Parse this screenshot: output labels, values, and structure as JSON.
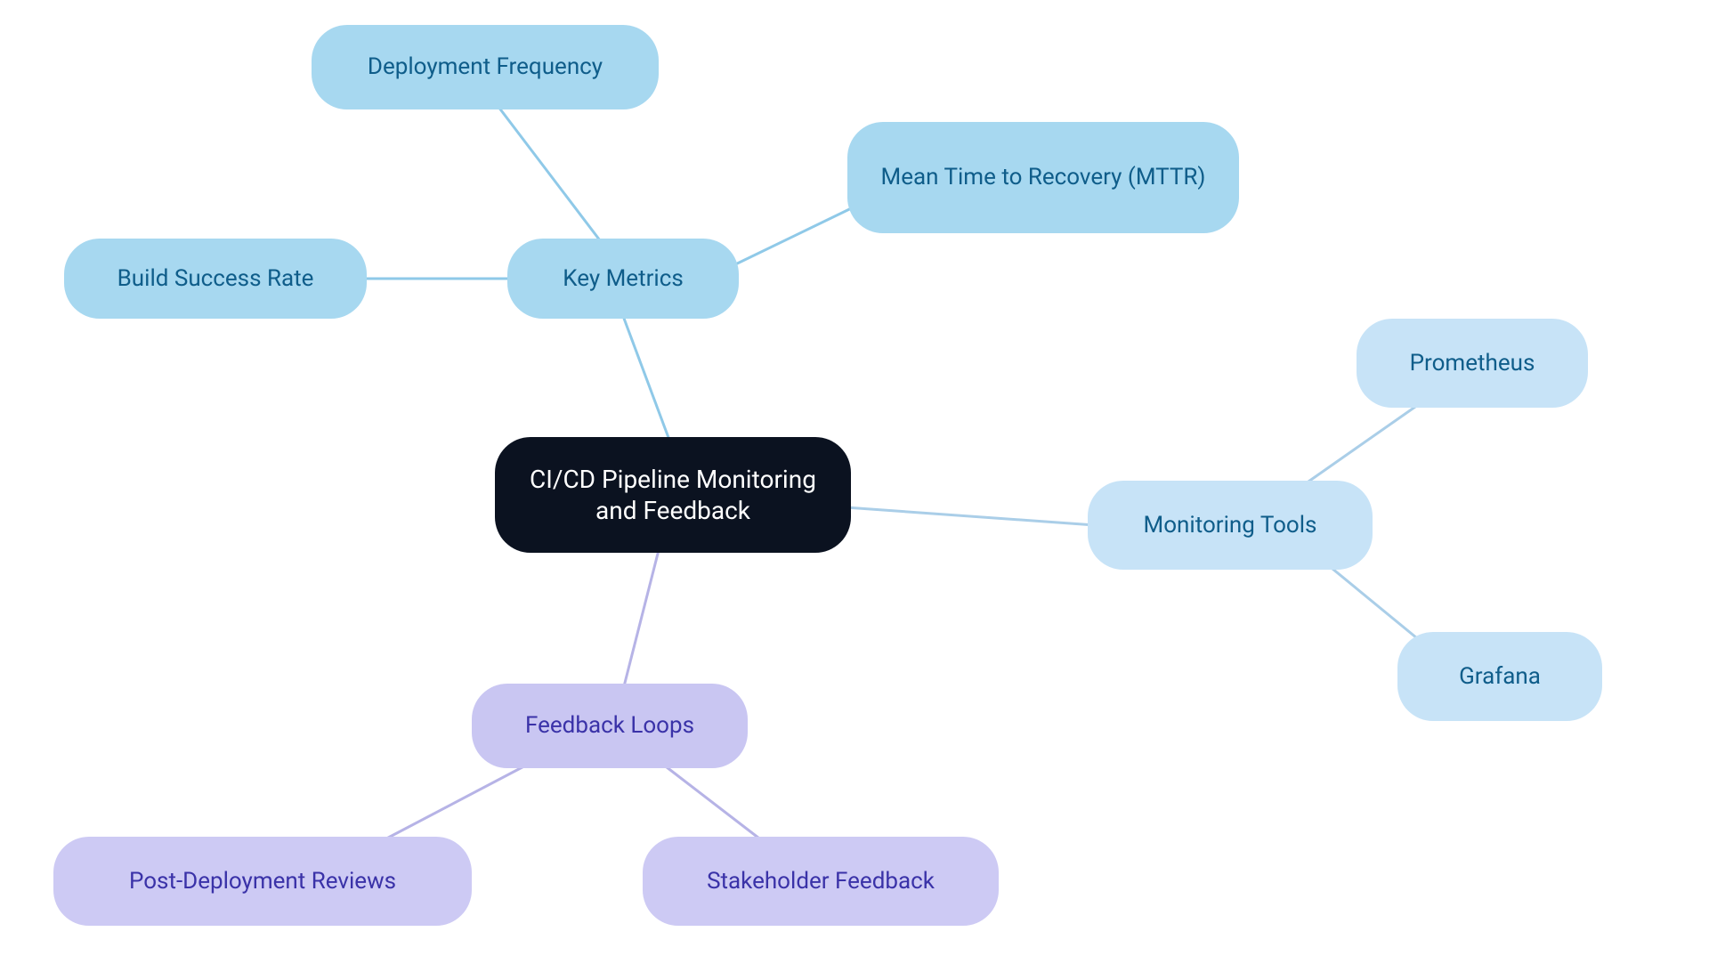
{
  "root": {
    "label": "CI/CD Pipeline Monitoring and Feedback"
  },
  "branches": {
    "key_metrics": {
      "label": "Key Metrics",
      "children": {
        "deployment_frequency": "Deployment Frequency",
        "build_success_rate": "Build Success Rate",
        "mttr": "Mean Time to Recovery (MTTR)"
      }
    },
    "monitoring_tools": {
      "label": "Monitoring Tools",
      "children": {
        "prometheus": "Prometheus",
        "grafana": "Grafana"
      }
    },
    "feedback_loops": {
      "label": "Feedback Loops",
      "children": {
        "post_deployment_reviews": "Post-Deployment Reviews",
        "stakeholder_feedback": "Stakeholder Feedback"
      }
    }
  },
  "colors": {
    "root_bg": "#0b1220",
    "root_text": "#ffffff",
    "blue_mid": "#a7d8f0",
    "blue_light": "#c7e3f7",
    "blue_text": "#0f5d8a",
    "purple_mid": "#c9c6f2",
    "purple_light": "#cdcaf4",
    "purple_text": "#3a32a8",
    "edge_blue": "#8fc9e8",
    "edge_lightblue": "#aacee8",
    "edge_purple": "#b6b3e6"
  }
}
